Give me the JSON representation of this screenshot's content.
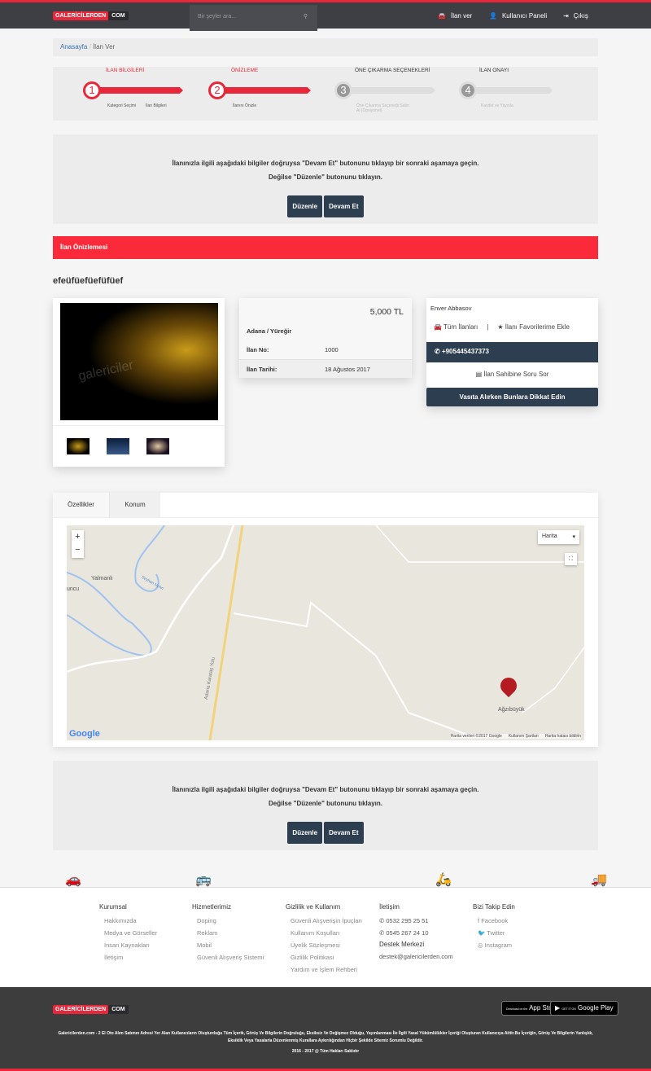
{
  "header": {
    "logo_left": "GALERİCİLERDEN",
    "logo_right": "COM",
    "search_placeholder": "Bir şeyler ara...",
    "nav": [
      {
        "label": "İlan ver",
        "icon": "car-icon"
      },
      {
        "label": "Kullanıcı Paneli",
        "icon": "user-icon"
      },
      {
        "label": "Çıkış",
        "icon": "logout-icon"
      }
    ]
  },
  "breadcrumb": {
    "home": "Anasayfa",
    "sep": "/",
    "current": "İlan Ver"
  },
  "steps": [
    {
      "num": "1",
      "title": "İLAN BİLGİLERİ",
      "subs": [
        "Kategori Seçimi",
        "İlan Bilgileri"
      ],
      "active": true
    },
    {
      "num": "2",
      "title": "ÖNİZLEME",
      "subs": [
        "İlanını Önizle"
      ],
      "active": true
    },
    {
      "num": "3",
      "title": "ÖNE ÇIKARMA SEÇENEKLERİ",
      "subs": [
        "Öne Çıkarma Seçeneği Satın Al (Opsiyonel)"
      ],
      "active": false
    },
    {
      "num": "4",
      "title": "İLAN ONAYI",
      "subs": [
        "Kaydet ve Yayınla"
      ],
      "active": false
    }
  ],
  "notice": {
    "line1": "İlanınızla ilgili aşağıdaki bilgiler doğruysa \"Devam Et\" butonunu tıklayıp bir sonraki aşamaya geçin.",
    "line2": "Değilse \"Düzenle\" butonunu tıklayın.",
    "edit": "Düzenle",
    "continue": "Devam Et"
  },
  "preview": {
    "header": "İlan Önizlemesi",
    "title": "efeüfüefüefüfüef",
    "watermark": "galericiler"
  },
  "details": {
    "price": "5,000 TL",
    "location": "Adana / Yüreğir",
    "no_label": "İlan No:",
    "no": "1000",
    "date_label": "İlan Tarihi:",
    "date": "18 Ağustos 2017"
  },
  "seller": {
    "name": "Enver Abbasov",
    "all_ads": "Tüm İlanları",
    "sep": "|",
    "favorite": "İlanı Favorilerime Ekle",
    "phone": "+905445437373",
    "ask": "İlan Sahibine Soru Sor",
    "tips": "Vasıta Alırken Bunlara Dikkat Edin"
  },
  "tabs": [
    {
      "label": "Özellikler",
      "active": true
    },
    {
      "label": "Konum",
      "active": false
    }
  ],
  "map": {
    "type": "Harita",
    "zoom_in": "+",
    "zoom_out": "−",
    "places": [
      "Yalmanlı",
      "uncu",
      "Ağzıbüyük",
      "Adana Karataş Yolu",
      "Seyhan Nehri"
    ],
    "google": "Google",
    "attrib": [
      "Harita verileri ©2017 Google",
      "Kullanım Şartları",
      "Harita hatası bildirin"
    ]
  },
  "footer": {
    "columns": [
      {
        "title": "Kurumsal",
        "items": [
          "Hakkımızda",
          "Medya ve Görseller",
          "İnsan Kaynakları",
          "İletişim"
        ]
      },
      {
        "title": "Hizmetlerimiz",
        "items": [
          "Doping",
          "Reklam",
          "Mobil",
          "Güvenli Alışveriş Sistemi"
        ]
      },
      {
        "title": "Gizlilik ve Kullanım",
        "items": [
          "Güvenli Alışverişin İpuçları",
          "Kullanım Koşulları",
          "Üyelik Sözleşmesi",
          "Gizlilik Politikası",
          "Yardım ve İşlem Rehberi"
        ]
      }
    ],
    "contact": {
      "title": "İletişim",
      "phone": "0532 295 25 51",
      "whatsapp": "0545 267 24 10",
      "support_title": "Destek Merkezi",
      "email": "destek@galericilerden.com"
    },
    "social": {
      "title": "Bizi Takip Edin",
      "items": [
        "Facebook",
        "Twitter",
        "Instagram"
      ]
    },
    "app_store": "App Store",
    "app_store_small": "Download on the",
    "google_play": "Google Play",
    "google_play_small": "GET IT ON",
    "disclaimer": "Galericilerden.com - 2 El Oto Alım Satımın Adresi Yer Alan Kullanıcıların Oluşturduğu Tüm İçerik, Görüş Ve Bilgilerin Doğruluğu, Eksiksiz Ve Değişmez Olduğu, Yayınlanması İle İlgili Yasal Yükümlülükler İçeriği Oluşturan Kullanıcıya Aittir.Bu İçeriğin, Görüş Ve Bilgilerin Yanlışlık, Eksiklik Veya Yasalarla Düzenlenmiş Kurallara Aykırılığından Hiçbir Şekilde Sitemiz Sorumlu Değildir.",
    "copyright": "2016 - 2017 @ Tüm Hakları Saklıdır"
  },
  "colors": {
    "accent": "#e8283a",
    "dark": "#2c3e50",
    "header": "#3d3f45"
  }
}
